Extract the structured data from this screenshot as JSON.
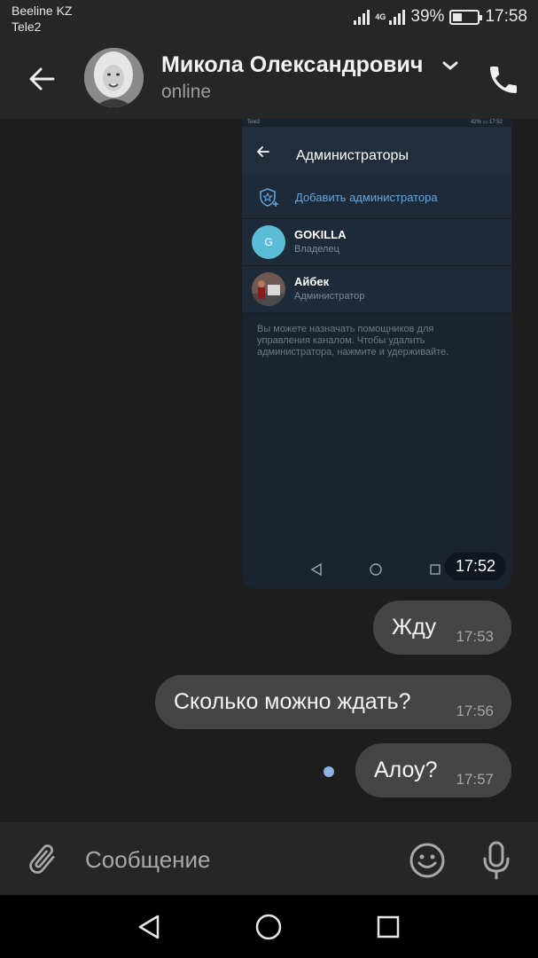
{
  "status_bar": {
    "carrier_1": "Beeline KZ",
    "carrier_2": "Tele2",
    "network_type": "4G",
    "battery_percent": "39%",
    "battery_level": 0.39,
    "time": "17:58"
  },
  "header": {
    "contact_name": "Микола Олександрович",
    "contact_status": "online"
  },
  "screenshot_message": {
    "status_carrier": "Tele2",
    "status_right": "42% ▭ 17:52",
    "toolbar_title": "Администраторы",
    "add_admin_label": "Добавить администратора",
    "admins": [
      {
        "initial": "G",
        "name": "GOKILLA",
        "role": "Владелец",
        "avatar_color": "#5bbcd6"
      },
      {
        "initial": "",
        "name": "Айбек",
        "role": "Администратор",
        "avatar_color": "#6e5a52"
      }
    ],
    "hint": "Вы можете назначать помощников для управления каналом. Чтобы удалить администратора, нажмите и удерживайте.",
    "time": "17:52"
  },
  "messages": [
    {
      "text": "Жду",
      "time": "17:53"
    },
    {
      "text": "Сколько можно ждать?",
      "time": "17:56"
    },
    {
      "text": "Алоу?",
      "time": "17:57"
    }
  ],
  "input": {
    "placeholder": "Сообщение",
    "value": ""
  },
  "colors": {
    "background": "#1d1d1d",
    "header": "#262626",
    "bubble": "#454545",
    "accent": "#62a8e3",
    "unread_dot": "#8fb3e3"
  },
  "icons": {
    "back": "arrow-left-icon",
    "dropdown": "chevron-down-icon",
    "call": "phone-icon",
    "attach": "paperclip-icon",
    "emoji": "smiley-icon",
    "voice": "microphone-icon",
    "nav_back": "triangle-back-icon",
    "nav_home": "circle-home-icon",
    "nav_recents": "square-recents-icon"
  }
}
